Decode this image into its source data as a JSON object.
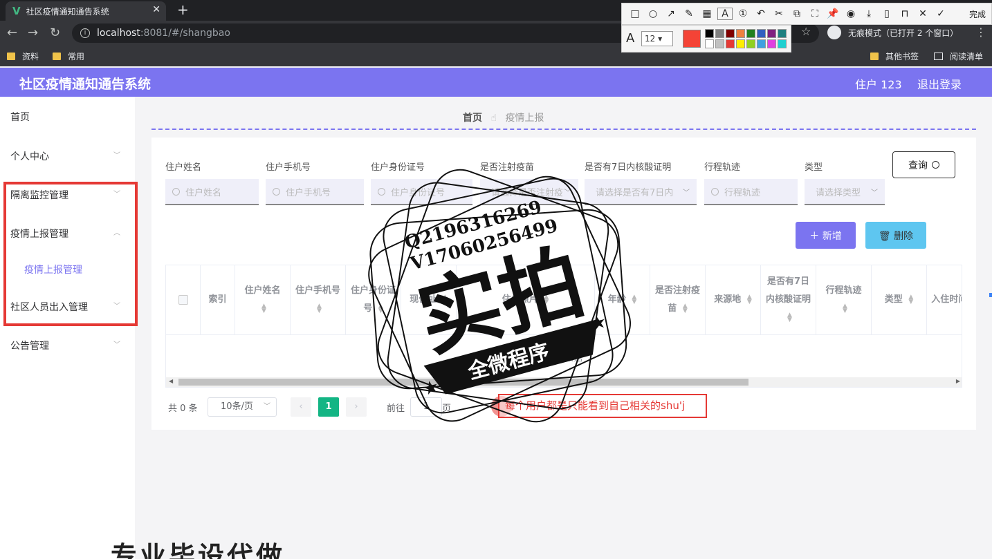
{
  "browser": {
    "tab_title": "社区疫情通知通告系统",
    "tab_logo": "V",
    "new_tab": "+",
    "close": "✕",
    "url_host": "localhost",
    "url_rest": ":8081/#/shangbao",
    "incognito": "无痕模式（已打开 2 个窗口）",
    "bookmarks": [
      "资料",
      "常用"
    ],
    "bookmarks_right": [
      "其他书签",
      "阅读清单"
    ]
  },
  "annotation_toolbar": {
    "done_label": "完成",
    "font_size": "12",
    "current_color": "#f44336",
    "palette": [
      "#000000",
      "#808080",
      "#800000",
      "#f08040",
      "#208020",
      "#3060c0",
      "#802080",
      "#208080",
      "#ffffff",
      "#c0c0c0",
      "#e53935",
      "#ffee00",
      "#90d020",
      "#40a0e0",
      "#e040e0",
      "#20d0d0"
    ]
  },
  "app": {
    "title": "社区疫情通知通告系统",
    "user": "住户 123",
    "logout": "退出登录",
    "accent": "#7b74f0"
  },
  "sidebar": {
    "items": [
      {
        "label": "首页"
      },
      {
        "label": "个人中心"
      },
      {
        "label": "隔离监控管理"
      },
      {
        "label": "疫情上报管理"
      },
      {
        "label": "疫情上报管理"
      },
      {
        "label": "社区人员出入管理"
      },
      {
        "label": "公告管理"
      }
    ]
  },
  "breadcrumb": {
    "home": "首页",
    "current": "疫情上报"
  },
  "filters": {
    "name_label": "住户姓名",
    "name_ph": "住户姓名",
    "phone_label": "住户手机号",
    "phone_ph": "住户手机号",
    "id_label": "住户身份证号",
    "id_ph": "住户身份证号",
    "vaccine_label": "是否注射疫苗",
    "vaccine_ph": "请选择是否注射疫苗",
    "test_label": "是否有7日内核酸证明",
    "test_ph": "请选择是否有7日内",
    "trip_label": "行程轨迹",
    "trip_ph": "行程轨迹",
    "type_label": "类型",
    "type_ph": "请选择类型",
    "query": "查询"
  },
  "actions": {
    "add": "＋ 新增",
    "delete": "🗑 删除"
  },
  "table": {
    "columns": [
      "索引",
      "住户姓名",
      "住户手机号",
      "住户身份证号",
      "现住址",
      "住户照片",
      "年龄",
      "是否注射疫苗",
      "来源地",
      "是否有7日内核酸证明",
      "行程轨迹",
      "类型",
      "入住时间"
    ],
    "empty": "暂无数据"
  },
  "pager": {
    "total": "共 0 条",
    "size": "10条/页",
    "current": "1",
    "goto": "前往",
    "jump": "1",
    "page": "页",
    "prev": "‹",
    "next": "›"
  },
  "note": "每个用户都是只能看到自己相关的shu'j",
  "watermark": {
    "line1": "Q2196316269",
    "line2": "V17060256499",
    "big": "实拍",
    "band": "全微程序"
  },
  "bottom_text": "专业毕设代做"
}
